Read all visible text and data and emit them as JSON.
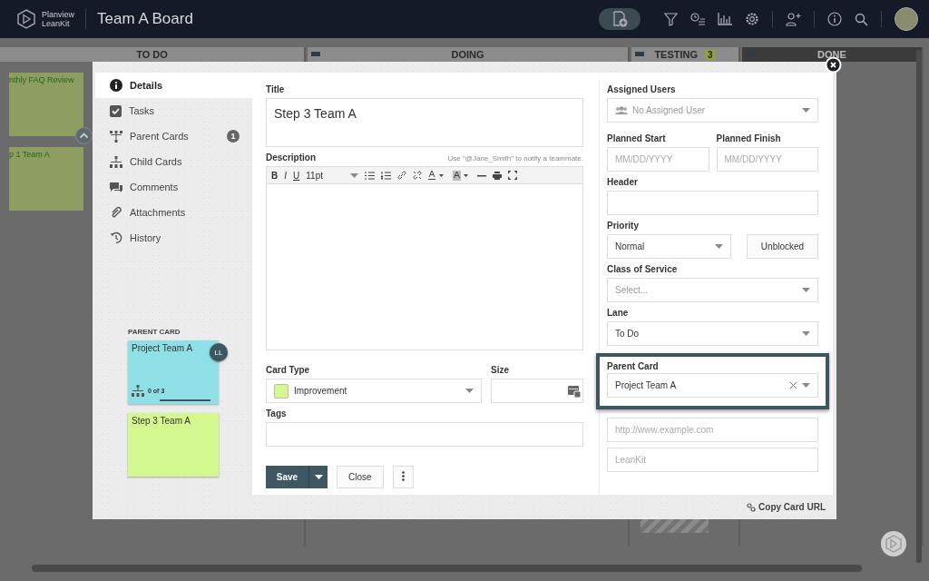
{
  "app": {
    "brand": [
      "Planview",
      "LeanKit"
    ],
    "board_title": "Team A Board"
  },
  "board": {
    "columns": [
      {
        "title": "TO DO",
        "kind": "todo"
      },
      {
        "title": "DOING",
        "kind": "doing"
      },
      {
        "title": "TESTING",
        "kind": "testing",
        "count": "3"
      },
      {
        "title": "DONE",
        "kind": "done"
      }
    ],
    "cards": [
      {
        "title": "nthly FAQ Review"
      },
      {
        "title": "p 1 Team A"
      }
    ]
  },
  "modal": {
    "nav": [
      {
        "label": "Details",
        "kind": "info",
        "selected": true
      },
      {
        "label": "Tasks",
        "kind": "check",
        "selected": false
      },
      {
        "label": "Parent Cards",
        "kind": "parent",
        "selected": false,
        "badge": "1"
      },
      {
        "label": "Child Cards",
        "kind": "child",
        "selected": false
      },
      {
        "label": "Comments",
        "kind": "comment",
        "selected": false
      },
      {
        "label": "Attachments",
        "kind": "clip",
        "selected": false
      },
      {
        "label": "History",
        "kind": "history",
        "selected": false
      }
    ],
    "parent_heading": "PARENT CARD",
    "parent_card": {
      "title": "Project Team A",
      "avatar": "LL",
      "progress": "0 of 3",
      "color": "#8fdfe6"
    },
    "current_card": {
      "title": "Step 3 Team A",
      "color": "#d4f78f"
    },
    "title": {
      "label": "Title",
      "value": "Step 3 Team A"
    },
    "description": {
      "label": "Description",
      "hint": "Use \"@Jane_Smith\" to notify a teammate.",
      "format_buttons": [
        "B",
        "I",
        "U"
      ],
      "font_size": "11pt"
    },
    "card_type": {
      "label": "Card Type",
      "value": "Improvement",
      "color": "#d4f78f"
    },
    "size": {
      "label": "Size"
    },
    "tags": {
      "label": "Tags"
    },
    "buttons": {
      "save": "Save",
      "close": "Close"
    },
    "assigned_users": {
      "label": "Assigned Users",
      "placeholder": "No Assigned User"
    },
    "planned_start": {
      "label": "Planned Start",
      "placeholder": "MM/DD/YYYY"
    },
    "planned_finish": {
      "label": "Planned Finish",
      "placeholder": "MM/DD/YYYY"
    },
    "header": {
      "label": "Header"
    },
    "priority": {
      "label": "Priority",
      "value": "Normal",
      "block_button": "Unblocked"
    },
    "class_of_service": {
      "label": "Class of Service",
      "placeholder": "Select..."
    },
    "lane": {
      "label": "Lane",
      "value": "To Do"
    },
    "parent_card_field": {
      "label": "Parent Card",
      "value": "Project Team A"
    },
    "external_link": {
      "placeholder": "http://www.example.com"
    },
    "external_link_label": {
      "placeholder": "LeanKit"
    },
    "copy_url": "Copy Card URL"
  }
}
